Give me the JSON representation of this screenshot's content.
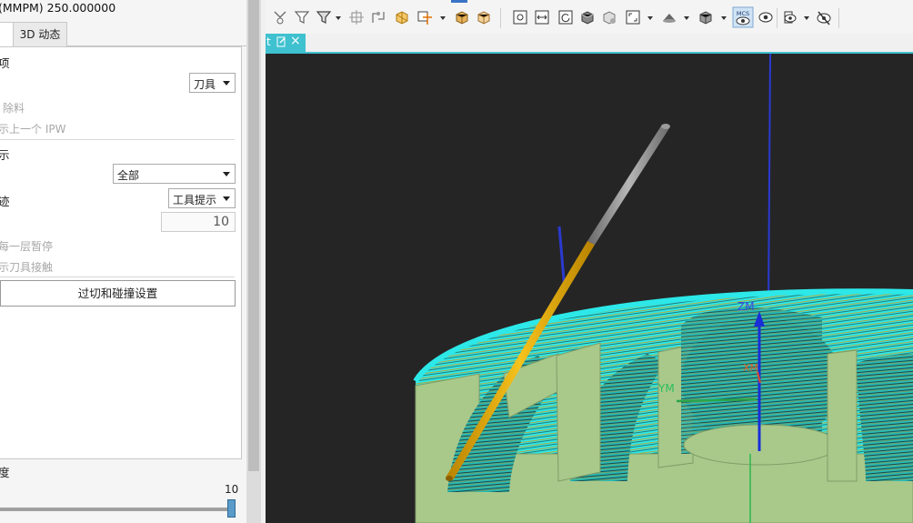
{
  "left_panel": {
    "feed_rate_text": "(MMPM) 250.000000",
    "tabs": [
      {
        "label": ""
      },
      {
        "label": "3D 动态"
      }
    ],
    "section_header_1": "项",
    "display_combo": {
      "value": "刀具"
    },
    "material_removal_label": "除料",
    "show_previous_ipw_label": "示上一个 IPW",
    "section_header_2": "示",
    "all_combo": {
      "value": "全部"
    },
    "tool_path_label": "迹",
    "tool_path_combo": {
      "value": "工具提示"
    },
    "count_label": "",
    "count_value": "10",
    "pause_each_layer_label": "每一层暂停",
    "show_tool_contact_label": "示刀具接触",
    "collision_button_label": "过切和碰撞设置",
    "speed_label": "度",
    "speed_value": "10",
    "speed_fraction": 1.0
  },
  "toolbar": {
    "icons": [
      "filter-path-icon",
      "filter-tool-icon",
      "select-filter-icon",
      "move-icon",
      "transform-icon",
      "orient-wcs-icon",
      "point-snap-icon",
      "box-icon",
      "block-icon",
      "fit-view-icon",
      "fit-width-icon",
      "refresh-view-icon",
      "shaded-cube-icon",
      "shaded-edges-icon",
      "zoom-window-icon",
      "render-style-icon",
      "view-cube-icon",
      "mcs-view-icon",
      "eye-view-icon",
      "show-hide-icon",
      "hide-icon"
    ],
    "accent_color": "#3b73c5"
  },
  "document_tab": {
    "title": "t",
    "accent_color": "#3fc1d0"
  },
  "viewport": {
    "axis_labels": {
      "zm": "ZM",
      "ym": "YM",
      "xm": "XM"
    },
    "background_color": "#252526",
    "part_color": "#a9c98b",
    "path_color": "#23e5e5",
    "tool_color": "#e3ae0f"
  }
}
